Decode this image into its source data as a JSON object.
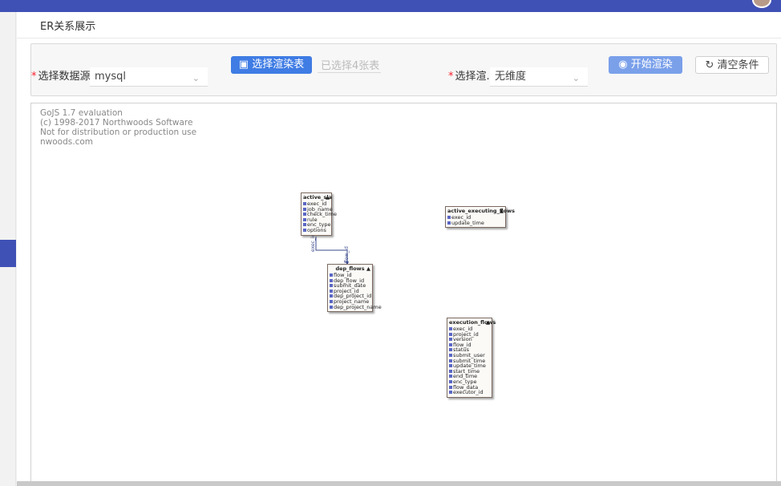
{
  "page": {
    "title": "ER关系展示"
  },
  "form": {
    "datasource_label": "选择数据源",
    "datasource_value": "mysql",
    "select_table_button": "选择渲染表",
    "selected_hint": "已选择4张表",
    "dimension_label": "选择渲...",
    "dimension_value": "无维度",
    "render_button": "开始渲染",
    "clear_button": "清空条件"
  },
  "diagram": {
    "watermark": [
      "GoJS 1.7 evaluation",
      "(c) 1998-2017 Northwoods Software",
      "Not for distribution or production use",
      "nwoods.com"
    ],
    "entities": [
      {
        "title": "active_sla",
        "fields": [
          "exec_id",
          "job_name",
          "check_time",
          "rule",
          "enc_type",
          "options"
        ]
      },
      {
        "title": "active_executing_flows",
        "fields": [
          "exec_id",
          "update_time"
        ]
      },
      {
        "title": "dep_flows",
        "fields": [
          "flow_id",
          "dep_flow_id",
          "submit_date",
          "project_id",
          "dep_project_id",
          "project_name",
          "dep_project_name"
        ]
      },
      {
        "title": "execution_flows",
        "fields": [
          "exec_id",
          "project_id",
          "version",
          "flow_id",
          "status",
          "submit_user",
          "submit_time",
          "update_time",
          "start_time",
          "end_time",
          "enc_type",
          "flow_data",
          "executor_id"
        ]
      }
    ],
    "links": [
      {
        "from_label": "exec_id",
        "to_label": "flow_id"
      }
    ]
  }
}
